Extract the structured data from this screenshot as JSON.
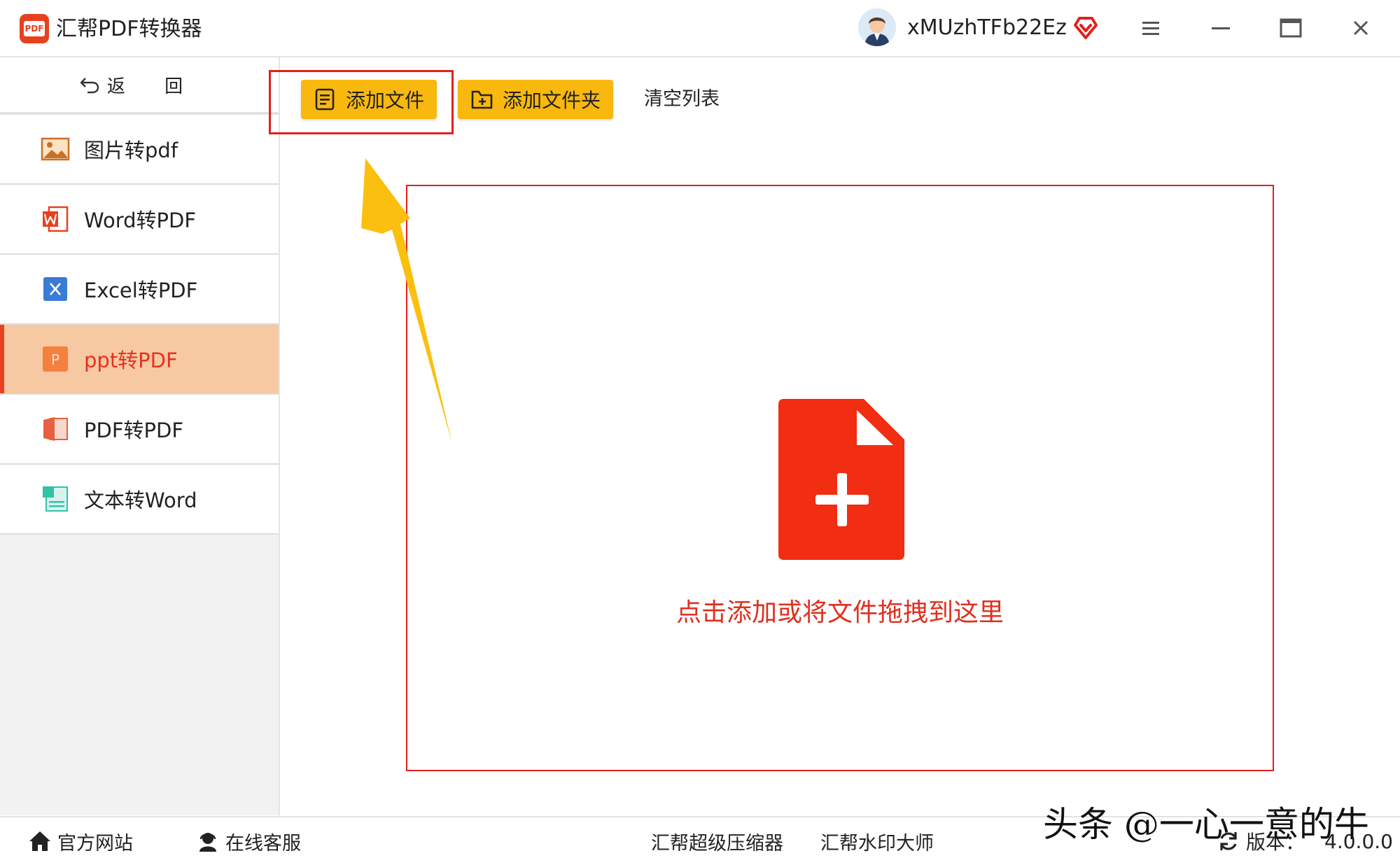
{
  "app": {
    "title": "汇帮PDF转换器",
    "logo_text": "PDF",
    "username": "xMUzhTFb22Ez"
  },
  "sidebar": {
    "back_label": "返 回",
    "items": [
      {
        "label": "图片转pdf",
        "icon": "image-icon"
      },
      {
        "label": "Word转PDF",
        "icon": "word-icon"
      },
      {
        "label": "Excel转PDF",
        "icon": "excel-icon"
      },
      {
        "label": "ppt转PDF",
        "icon": "ppt-icon",
        "active": true
      },
      {
        "label": "PDF转PDF",
        "icon": "pdf-icon"
      },
      {
        "label": "文本转Word",
        "icon": "text-icon"
      }
    ]
  },
  "toolbar": {
    "add_file": "添加文件",
    "add_folder": "添加文件夹",
    "clear_list": "清空列表"
  },
  "dropzone": {
    "hint": "点击添加或将文件拖拽到这里"
  },
  "footer": {
    "official_site": "官方网站",
    "online_service": "在线客服",
    "compressor": "汇帮超级压缩器",
    "watermark_master": "汇帮水印大师",
    "version_label": "版本：",
    "version_number": "4.0.0.0"
  },
  "overlay": {
    "watermark": "头条 @一心一意的牛"
  },
  "colors": {
    "accent_red": "#e0211e",
    "button_yellow": "#f9b80d",
    "active_bg": "#f7c9a2"
  }
}
